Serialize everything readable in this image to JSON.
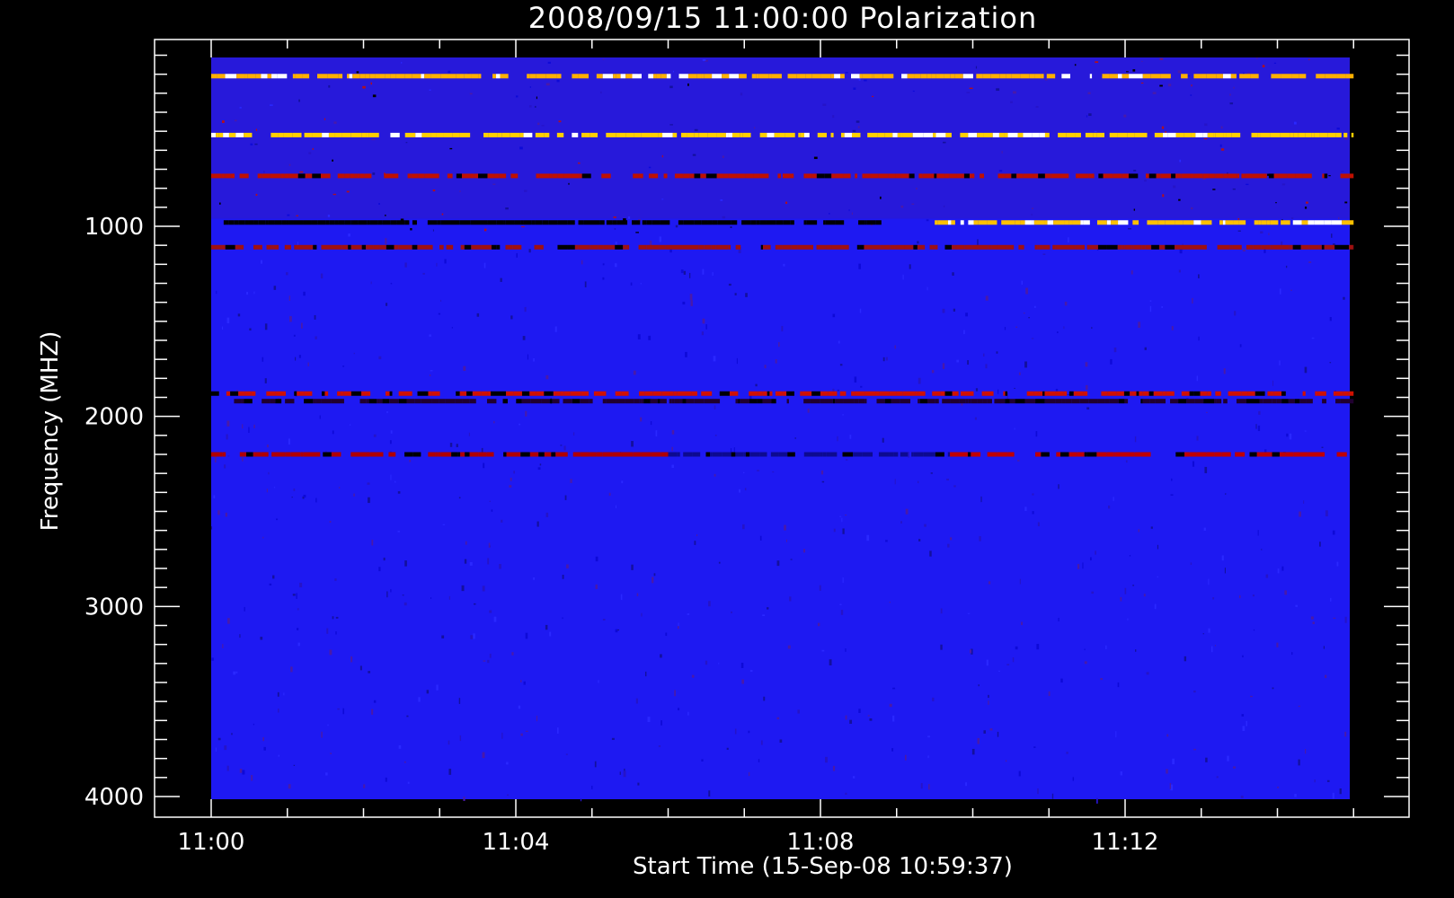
{
  "chart_data": {
    "type": "heatmap",
    "title": "2008/09/15 11:00:00 Polarization",
    "xlabel": "Start Time (15-Sep-08 10:59:37)",
    "ylabel": "Frequency (MHZ)",
    "x_tick_labels": [
      "11:00",
      "11:04",
      "11:08",
      "11:12"
    ],
    "x_tick_values_min": [
      0,
      4,
      8,
      12
    ],
    "y_tick_labels": [
      "1000",
      "2000",
      "3000",
      "4000"
    ],
    "y_tick_values": [
      1000,
      2000,
      3000,
      4000
    ],
    "xlim_min": [
      0,
      15
    ],
    "ylim": [
      4000,
      100
    ],
    "y_inverted": true,
    "grid": false,
    "legend": "none",
    "colormap": [
      "#000000",
      "#1a1aff",
      "#d01000",
      "#ffd000",
      "#ffffff"
    ],
    "background_level_color": "#1e19f2",
    "features": [
      {
        "freq_mhz": 210,
        "t_start": 0,
        "t_end": 15,
        "intensity": "high",
        "color": "#ffb000"
      },
      {
        "freq_mhz": 520,
        "t_start": 0,
        "t_end": 15,
        "intensity": "high",
        "color": "#ffd000"
      },
      {
        "freq_mhz": 735,
        "t_start": 0,
        "t_end": 15,
        "intensity": "moderate",
        "color": "#c01000"
      },
      {
        "freq_mhz": 980,
        "t_start": 0,
        "t_end": 8.8,
        "intensity": "low",
        "color": "#000000"
      },
      {
        "freq_mhz": 980,
        "t_start": 9.5,
        "t_end": 15,
        "intensity": "high",
        "color": "#ffc000"
      },
      {
        "freq_mhz": 1110,
        "t_start": 0,
        "t_end": 15,
        "intensity": "moderate",
        "color": "#a01010"
      },
      {
        "freq_mhz": 1880,
        "t_start": 0,
        "t_end": 15,
        "intensity": "moderate",
        "color": "#d01000"
      },
      {
        "freq_mhz": 1920,
        "t_start": 0.3,
        "t_end": 15,
        "intensity": "mixed",
        "color": "#200030"
      },
      {
        "freq_mhz": 2200,
        "t_start": 0,
        "t_end": 6,
        "intensity": "moderate",
        "color": "#b00000"
      },
      {
        "freq_mhz": 2200,
        "t_start": 6,
        "t_end": 9.7,
        "intensity": "low",
        "color": "#0d0a90"
      },
      {
        "freq_mhz": 2200,
        "t_start": 9.7,
        "t_end": 15,
        "intensity": "moderate",
        "color": "#c00000"
      }
    ]
  }
}
